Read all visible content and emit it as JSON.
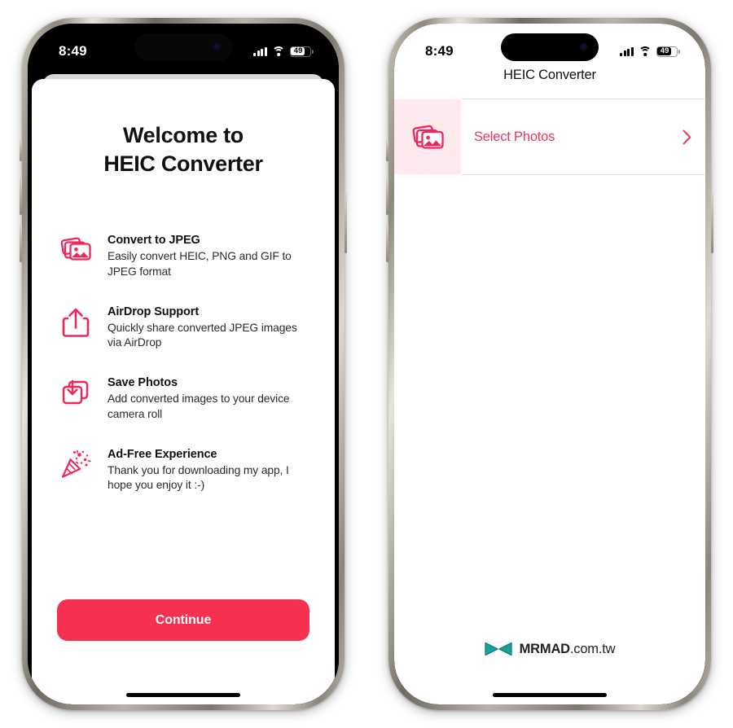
{
  "theme": {
    "accent": "#F6304F",
    "accent_link": "#E8375C",
    "tile_bg": "#FDEAEF",
    "logo_teal": "#17A09A"
  },
  "left_phone": {
    "status_bar": {
      "time": "8:49",
      "battery_level": "49",
      "signal_icon": "cellular-bars-icon",
      "wifi_icon": "wifi-icon",
      "battery_icon": "battery-icon"
    },
    "welcome": {
      "line1": "Welcome to",
      "line2": "HEIC Converter"
    },
    "features": [
      {
        "icon": "photo-stack-icon",
        "title": "Convert to JPEG",
        "desc": "Easily convert HEIC, PNG and GIF to JPEG format"
      },
      {
        "icon": "share-export-icon",
        "title": "AirDrop Support",
        "desc": "Quickly share converted JPEG images via AirDrop"
      },
      {
        "icon": "download-stack-icon",
        "title": "Save Photos",
        "desc": "Add converted images to your device camera roll"
      },
      {
        "icon": "party-popper-icon",
        "title": "Ad-Free Experience",
        "desc": "Thank you for downloading my app, I hope you enjoy it :-)"
      }
    ],
    "cta": {
      "label": "Continue"
    }
  },
  "right_phone": {
    "status_bar": {
      "time": "8:49",
      "battery_level": "49",
      "signal_icon": "cellular-bars-icon",
      "wifi_icon": "wifi-icon",
      "battery_icon": "battery-icon"
    },
    "nav_title": "HEIC Converter",
    "row": {
      "icon": "photo-stack-icon",
      "label": "Select Photos",
      "chevron": "chevron-right-icon"
    },
    "watermark": {
      "logo": "mrmad-bowtie-logo",
      "brand": "MRMAD",
      "domain": ".com.tw"
    }
  }
}
